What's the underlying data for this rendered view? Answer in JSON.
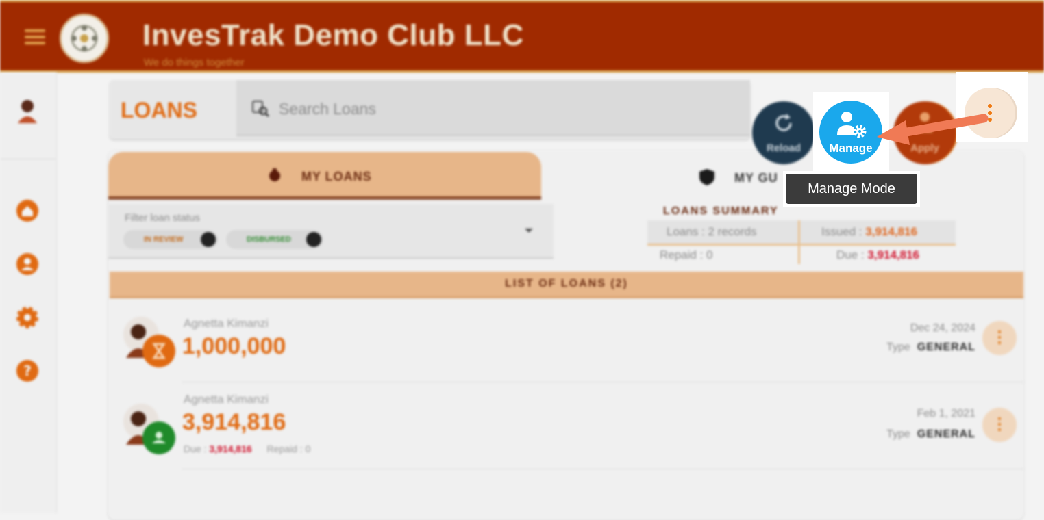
{
  "header": {
    "title": "InvesTrak Demo Club LLC",
    "subtitle": "We do things together"
  },
  "sidebar": {
    "items": [
      {
        "icon": "home-icon"
      },
      {
        "icon": "profile-icon"
      },
      {
        "icon": "gear-icon"
      },
      {
        "icon": "help-icon"
      }
    ]
  },
  "loans": {
    "title": "LOANS",
    "search_placeholder": "Search Loans"
  },
  "fabs": {
    "reload_label": "Reload",
    "manage_label": "Manage",
    "apply_label": "Apply",
    "tooltip": "Manage Mode"
  },
  "tabs": {
    "my_loans": "MY LOANS",
    "my_guarantees": "MY GU"
  },
  "filter": {
    "label": "Filter loan status",
    "chips": [
      "IN REVIEW",
      "DISBURSED"
    ]
  },
  "summary": {
    "title": "LOANS SUMMARY",
    "loans": "Loans : 2 records",
    "issued_label": "Issued :",
    "issued_value": "3,914,816",
    "repaid": "Repaid : 0",
    "due_label": "Due :",
    "due_value": "3,914,816"
  },
  "list": {
    "title": "LIST OF LOANS (2)",
    "type_label": "Type",
    "rows": [
      {
        "borrower": "Agnetta Kimanzi",
        "amount": "1,000,000",
        "date": "Dec 24, 2024",
        "type": "GENERAL",
        "status": "in-review"
      },
      {
        "borrower": "Agnetta Kimanzi",
        "amount": "3,914,816",
        "date": "Feb 1, 2021",
        "type": "GENERAL",
        "status": "disbursed",
        "due_label": "Due :",
        "due_value": "3,914,816",
        "repaid": "Repaid : 0"
      }
    ]
  },
  "colors": {
    "header_bg": "#a02a00",
    "accent_orange": "#e06a12",
    "manage_blue": "#1aa8ec",
    "arrow": "#f07a55"
  }
}
